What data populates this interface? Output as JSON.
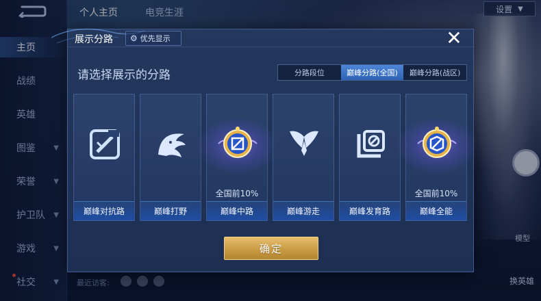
{
  "sidebar": {
    "items": [
      {
        "label": "主页",
        "active": true,
        "has_chevron": false
      },
      {
        "label": "战绩",
        "active": false,
        "has_chevron": false
      },
      {
        "label": "英雄",
        "active": false,
        "has_chevron": false
      },
      {
        "label": "图鉴",
        "active": false,
        "has_chevron": true
      },
      {
        "label": "荣誉",
        "active": false,
        "has_chevron": true
      },
      {
        "label": "护卫队",
        "active": false,
        "has_chevron": true
      },
      {
        "label": "游戏",
        "active": false,
        "has_chevron": true
      },
      {
        "label": "社交",
        "active": false,
        "has_chevron": true
      }
    ]
  },
  "top_tabs": [
    {
      "label": "个人主页",
      "active": true
    },
    {
      "label": "电竞生涯",
      "active": false
    }
  ],
  "settings_label": "设置",
  "model_label": "模型",
  "swap_hero_label": "换英雄",
  "recent_visitors_label": "最近访客:",
  "dialog": {
    "title": "展示分路",
    "priority_label": "优先显示",
    "close_symbol": "✕",
    "subtitle": "请选择展示的分路",
    "segments": [
      {
        "label": "分路段位",
        "active": false
      },
      {
        "label": "巅峰分路(全国)",
        "active": true
      },
      {
        "label": "巅峰分路(战区)",
        "active": false
      }
    ],
    "cards": [
      {
        "label": "巅峰对抗路",
        "rank": "",
        "icon": "clash-lane-icon",
        "glow": false
      },
      {
        "label": "巅峰打野",
        "rank": "",
        "icon": "jungle-icon",
        "glow": false
      },
      {
        "label": "巅峰中路",
        "rank": "全国前10%",
        "icon": "mid-lane-badge-icon",
        "glow": true
      },
      {
        "label": "巅峰游走",
        "rank": "",
        "icon": "roam-icon",
        "glow": false
      },
      {
        "label": "巅峰发育路",
        "rank": "",
        "icon": "farm-lane-icon",
        "glow": false
      },
      {
        "label": "巅峰全能",
        "rank": "全国前10%",
        "icon": "all-round-badge-icon",
        "glow": true
      }
    ],
    "confirm_label": "确定"
  },
  "colors": {
    "accent_blue": "#2f62b4",
    "confirm_gold": "#c99b45",
    "dialog_bg": "#1d2f52"
  }
}
